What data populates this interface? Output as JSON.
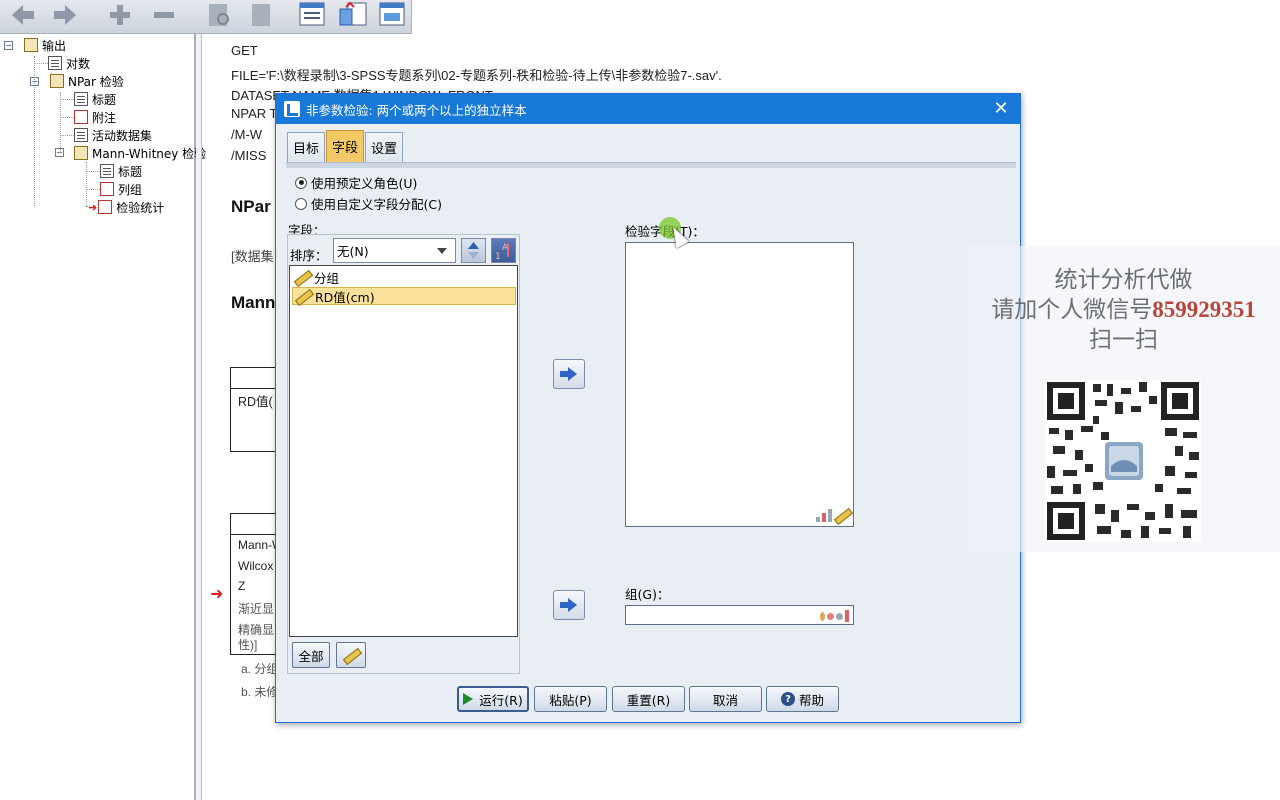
{
  "output_tree": {
    "items": [
      {
        "label": "输出"
      },
      {
        "label": "对数"
      },
      {
        "label": "NPar 检验"
      },
      {
        "label": "标题"
      },
      {
        "label": "附注"
      },
      {
        "label": "活动数据集"
      },
      {
        "label": "Mann-Whitney 检验"
      },
      {
        "label": "标题"
      },
      {
        "label": "列组"
      },
      {
        "label": "检验统计"
      }
    ]
  },
  "syntax": {
    "line1": "GET",
    "line2": "  FILE='F:\\数程录制\\3-SPSS专题系列\\02-专题系列-秩和检验-待上传\\非参数检验7-.sav'.",
    "line3": "DATASET NAME 数据集1 WINDOW=FRONT.",
    "line4": "NPAR T",
    "line5": "  /M-W",
    "line6": "  /MISS"
  },
  "output": {
    "heading1": "NPar",
    "dataset_ref": "[数据集",
    "heading2": "Mann",
    "table1_row": "RD值(",
    "table2_rows": [
      "Mann-W",
      "Wilcox",
      "Z",
      "渐近显",
      "精确显",
      "性)]"
    ],
    "footnote_a": "a. 分组",
    "footnote_b": "b. 未修"
  },
  "dialog": {
    "title": "非参数检验: 两个或两个以上的独立样本",
    "tabs": [
      "目标",
      "字段",
      "设置"
    ],
    "radio_predefined": "使用预定义角色(U)",
    "radio_custom": "使用自定义字段分配(C)",
    "fields_label": "字段：",
    "sort_label": "排序：",
    "sort_value": "无(N)",
    "fields": [
      "分组",
      "RD值(cm)"
    ],
    "all_button": "全部",
    "test_fields_label": "检验字段(T)：",
    "group_label": "组(G)：",
    "buttons": {
      "run": "运行(R)",
      "paste": "粘贴(P)",
      "reset": "重置(R)",
      "cancel": "取消",
      "help": "帮助"
    }
  },
  "watermark": {
    "line1": "统计分析代做",
    "line2_prefix": "请加个人微信号",
    "line2_number": "859929351",
    "line3": "扫一扫"
  }
}
